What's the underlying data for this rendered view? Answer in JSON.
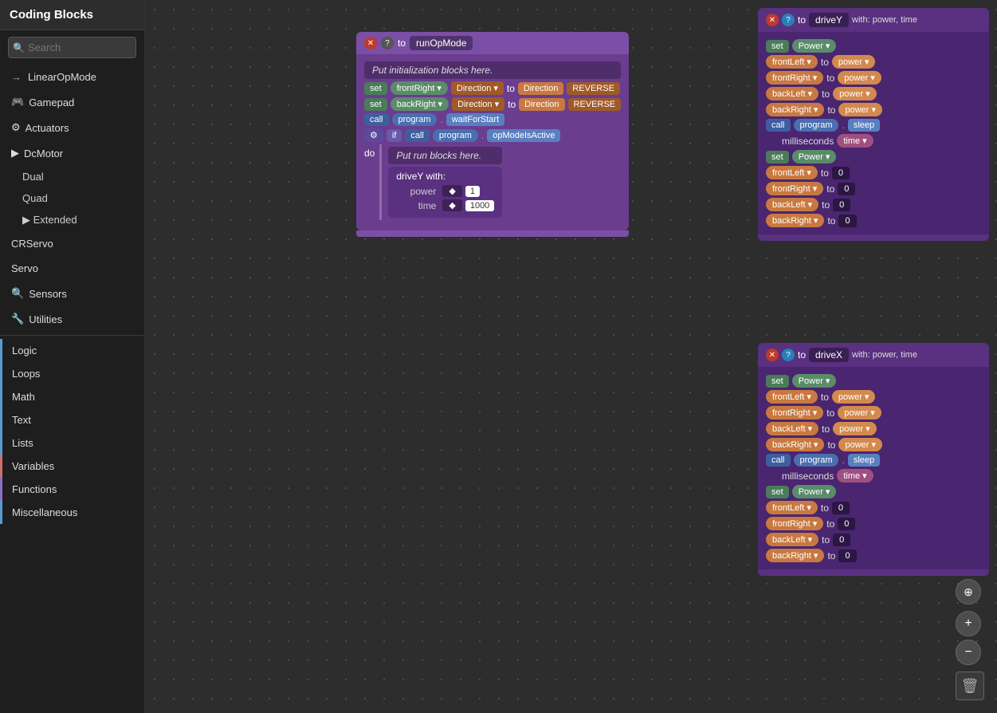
{
  "sidebar": {
    "title": "Coding Blocks",
    "search": {
      "placeholder": "Search"
    },
    "nav_items": [
      {
        "id": "linear-op-mode",
        "label": "LinearOpMode",
        "icon": "→"
      },
      {
        "id": "gamepad",
        "label": "Gamepad",
        "icon": "🎮"
      },
      {
        "id": "actuators",
        "label": "Actuators",
        "icon": "⚙"
      },
      {
        "id": "dc-motor",
        "label": "DcMotor",
        "icon": "▶",
        "expandable": true
      },
      {
        "id": "dual",
        "label": "Dual",
        "sub": true
      },
      {
        "id": "quad",
        "label": "Quad",
        "sub": true
      },
      {
        "id": "extended",
        "label": "Extended",
        "sub": true,
        "expandable": true
      },
      {
        "id": "crservo",
        "label": "CRServo",
        "sub": false
      },
      {
        "id": "servo",
        "label": "Servo",
        "sub": false
      },
      {
        "id": "sensors",
        "label": "Sensors",
        "icon": "🔍"
      },
      {
        "id": "utilities",
        "label": "Utilities",
        "icon": "🔧"
      }
    ],
    "categories": [
      {
        "id": "logic",
        "label": "Logic",
        "color": "#5b9bd5"
      },
      {
        "id": "loops",
        "label": "Loops",
        "color": "#5b9bd5"
      },
      {
        "id": "math",
        "label": "Math",
        "color": "#5b9bd5"
      },
      {
        "id": "text",
        "label": "Text",
        "color": "#5b9bd5"
      },
      {
        "id": "lists",
        "label": "Lists",
        "color": "#5b9bd5"
      },
      {
        "id": "variables",
        "label": "Variables",
        "color": "#c97070"
      },
      {
        "id": "functions",
        "label": "Functions",
        "color": "#8a70c9"
      },
      {
        "id": "miscellaneous",
        "label": "Miscellaneous",
        "color": "#5b9bd5"
      }
    ]
  },
  "main_block": {
    "header": {
      "keyword": "to",
      "name": "runOpMode"
    },
    "init_placeholder": "Put initialization blocks here.",
    "rows": [
      {
        "type": "set",
        "var": "frontRight",
        "dropdown1": "Direction",
        "keyword": "to",
        "value1": "Direction",
        "value2": "REVERSE"
      },
      {
        "type": "set",
        "var": "backRight",
        "dropdown1": "Direction",
        "keyword": "to",
        "value1": "Direction",
        "value2": "REVERSE"
      },
      {
        "type": "call",
        "obj": "program",
        "method": "waitForStart"
      },
      {
        "type": "if",
        "condition_obj": "program",
        "condition_method": "opModeIsActive"
      },
      {
        "type": "do_placeholder",
        "text": "Put run blocks here."
      },
      {
        "type": "call_indent",
        "name": "driveY",
        "params": [
          {
            "label": "power",
            "value": "1"
          },
          {
            "label": "time",
            "value": "1000"
          }
        ]
      }
    ]
  },
  "driveY_block": {
    "header": {
      "keyword": "to",
      "name": "driveY",
      "params": "with: power, time"
    },
    "rows": [
      {
        "type": "set",
        "var": "Power",
        "has_dropdown": true
      },
      {
        "type": "motor_set",
        "motor": "frontLeft",
        "keyword": "to",
        "value": "power"
      },
      {
        "type": "motor_set",
        "motor": "frontRight",
        "keyword": "to",
        "value": "power"
      },
      {
        "type": "motor_set",
        "motor": "backLeft",
        "keyword": "to",
        "value": "power"
      },
      {
        "type": "motor_set",
        "motor": "backRight",
        "keyword": "to",
        "value": "power"
      },
      {
        "type": "call_sleep",
        "obj": "program",
        "method": "sleep"
      },
      {
        "type": "millis",
        "param": "time"
      },
      {
        "type": "set",
        "var": "Power",
        "has_dropdown": true
      },
      {
        "type": "motor_set_zero",
        "motor": "frontLeft",
        "keyword": "to",
        "value": "0"
      },
      {
        "type": "motor_set_zero",
        "motor": "frontRight",
        "keyword": "to",
        "value": "0"
      },
      {
        "type": "motor_set_zero",
        "motor": "backLeft",
        "keyword": "to",
        "value": "0"
      },
      {
        "type": "motor_set_zero",
        "motor": "backRight",
        "keyword": "to",
        "value": "0"
      }
    ]
  },
  "driveX_block": {
    "header": {
      "keyword": "to",
      "name": "driveX",
      "params": "with: power, time"
    },
    "rows": [
      {
        "type": "set",
        "var": "Power",
        "has_dropdown": true
      },
      {
        "type": "motor_set",
        "motor": "frontLeft",
        "keyword": "to",
        "value": "power"
      },
      {
        "type": "motor_set",
        "motor": "frontRight",
        "keyword": "to",
        "value": "power"
      },
      {
        "type": "motor_set",
        "motor": "backLeft",
        "keyword": "to",
        "value": "power"
      },
      {
        "type": "motor_set",
        "motor": "backRight",
        "keyword": "to",
        "value": "power"
      },
      {
        "type": "call_sleep",
        "obj": "program",
        "method": "sleep"
      },
      {
        "type": "millis",
        "param": "time"
      },
      {
        "type": "set",
        "var": "Power",
        "has_dropdown": true
      },
      {
        "type": "motor_set_zero",
        "motor": "frontLeft",
        "keyword": "to",
        "value": "0"
      },
      {
        "type": "motor_set_zero",
        "motor": "frontRight",
        "keyword": "to",
        "value": "0"
      },
      {
        "type": "motor_set_zero",
        "motor": "backLeft",
        "keyword": "to",
        "value": "0"
      },
      {
        "type": "motor_set_zero",
        "motor": "backRight",
        "keyword": "to",
        "value": "0"
      }
    ]
  },
  "zoom": {
    "nav_label": "⊕",
    "plus_label": "+",
    "minus_label": "−"
  },
  "trash": {
    "icon": "🗑"
  }
}
